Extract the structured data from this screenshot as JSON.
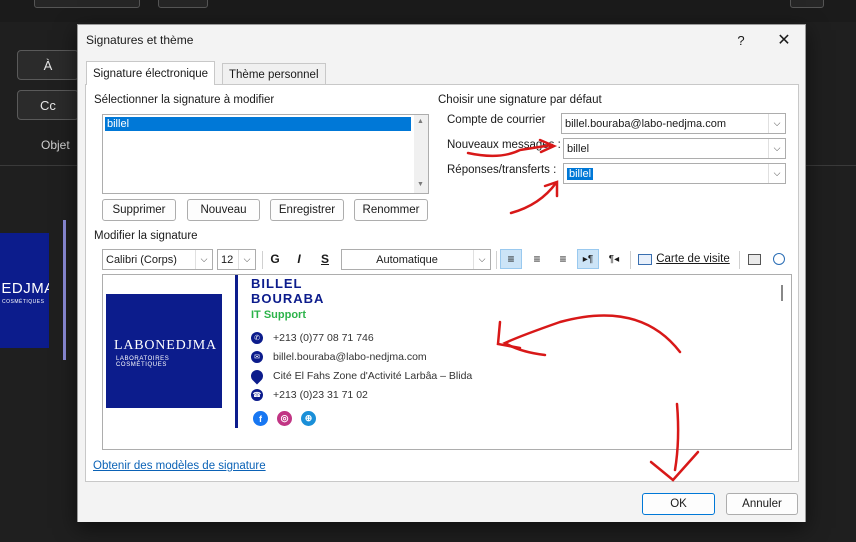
{
  "background": {
    "to_button": "À",
    "cc_button": "Cc",
    "subject_label": "Objet",
    "logo_text": "LABONEDJMA",
    "logo_sub": "COSMÉTIQUES"
  },
  "dialog": {
    "title": "Signatures et thème",
    "help": "?",
    "close": "✕"
  },
  "tabs": [
    {
      "label": "Signature électronique",
      "active": true
    },
    {
      "label": "Thème personnel",
      "active": false
    }
  ],
  "select_section": {
    "label": "Sélectionner la signature à modifier",
    "items": [
      "billel"
    ],
    "selected": "billel"
  },
  "buttons": {
    "delete": "Supprimer",
    "new": "Nouveau",
    "save": "Enregistrer",
    "rename": "Renommer",
    "ok": "OK",
    "cancel": "Annuler"
  },
  "default_section": {
    "label": "Choisir une signature par défaut",
    "account_label": "Compte de courrier",
    "account_value": "billel.bouraba@labo-nedjma.com",
    "new_messages_label": "Nouveaux messages :",
    "new_messages_value": "billel",
    "replies_label": "Réponses/transferts :",
    "replies_value": "billel"
  },
  "editor_section": {
    "label": "Modifier la signature",
    "font": "Calibri (Corps)",
    "size": "12",
    "bold": "G",
    "italic": "I",
    "underline": "S",
    "color": "Automatique",
    "business_card": "Carte de visite"
  },
  "signature": {
    "logo_main": "LABONEDJMA",
    "logo_sub": "LABORATOIRES COSMÉTIQUES",
    "first_name": "BILLEL",
    "last_name": "BOURABA",
    "role": "IT Support",
    "mobile": "+213 (0)77 08 71 746",
    "email": "billel.bouraba@labo-nedjma.com",
    "address": "Cité El Fahs Zone d'Activité Larbâa – Blida",
    "phone": "+213 (0)23 31 71 02"
  },
  "link": "Obtenir des modèles de signature",
  "colors": {
    "brand_blue": "#0c1c8c",
    "role_green": "#2cb34a",
    "selection": "#0078d7",
    "annotation_red": "#d81818"
  }
}
